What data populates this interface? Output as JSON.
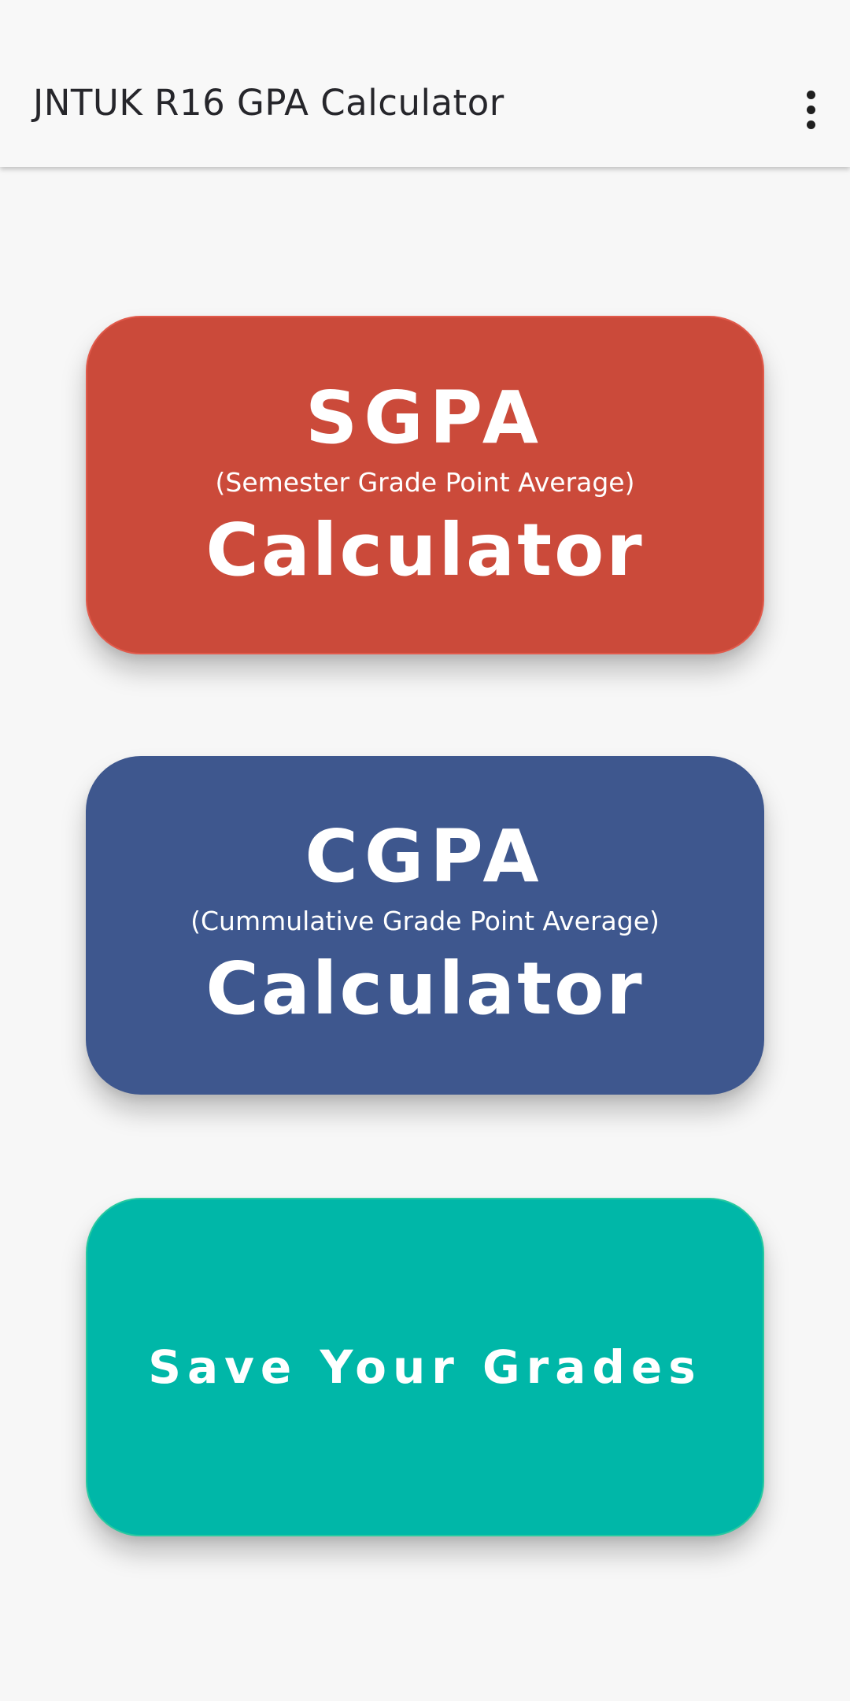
{
  "app_bar": {
    "title": "JNTUK R16 GPA Calculator",
    "menu_icon": "more-vert-icon"
  },
  "cards": {
    "sgpa": {
      "abbr": "SGPA",
      "full": "(Semester Grade Point Average)",
      "calc": "Calculator",
      "color": "#cb4a3a"
    },
    "cgpa": {
      "abbr": "CGPA",
      "full": "(Cummulative Grade Point Average)",
      "calc": "Calculator",
      "color": "#3e578e"
    },
    "save": {
      "label": "Save Your Grades",
      "color": "#00b7a8"
    }
  },
  "colors": {
    "background": "#f7f7f7",
    "app_bar": "#f8f8f8",
    "title_text": "#26262b"
  }
}
